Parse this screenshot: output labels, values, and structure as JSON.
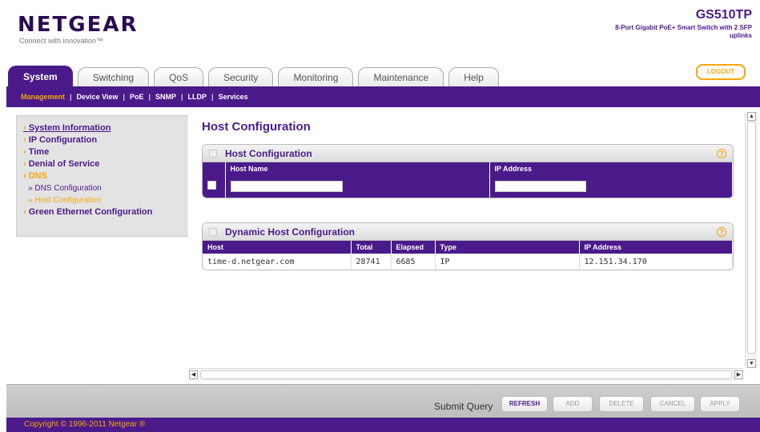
{
  "header": {
    "logo": "NETGEAR",
    "tagline": "Connect with Innovation™",
    "model": "GS510TP",
    "model_desc": "8-Port Gigabit PoE+ Smart Switch with 2 SFP uplinks",
    "logout_label": "LOGOUT"
  },
  "tabs": [
    {
      "label": "System"
    },
    {
      "label": "Switching"
    },
    {
      "label": "QoS"
    },
    {
      "label": "Security"
    },
    {
      "label": "Monitoring"
    },
    {
      "label": "Maintenance"
    },
    {
      "label": "Help"
    }
  ],
  "subnav": [
    {
      "label": "Management"
    },
    {
      "label": "Device View"
    },
    {
      "label": "PoE"
    },
    {
      "label": "SNMP"
    },
    {
      "label": "LLDP"
    },
    {
      "label": "Services"
    }
  ],
  "left_nav": {
    "items": [
      {
        "label": "System Information"
      },
      {
        "label": "IP Configuration"
      },
      {
        "label": "Time"
      },
      {
        "label": "Denial of Service"
      },
      {
        "label": "DNS"
      },
      {
        "label": "DNS Configuration"
      },
      {
        "label": "Host Configuration"
      },
      {
        "label": "Green Ethernet Configuration"
      }
    ]
  },
  "page_title": "Host Configuration",
  "host_config": {
    "title": "Host Configuration",
    "columns": [
      "Host Name",
      "IP Address"
    ]
  },
  "dynamic_host": {
    "title": "Dynamic Host Configuration",
    "columns": [
      "Host",
      "Total",
      "Elapsed",
      "Type",
      "IP Address"
    ],
    "rows": [
      {
        "host": "time-d.netgear.com",
        "total": "28741",
        "elapsed": "6685",
        "type": "IP",
        "ip": "12.151.34.170"
      }
    ]
  },
  "buttons": {
    "submit_label": "Submit Query",
    "refresh": "REFRESH",
    "add": "ADD",
    "delete": "DELETE",
    "cancel": "CANCEL",
    "apply": "APPLY"
  },
  "footer": "Copyright © 1996-2011 Netgear ®",
  "colors": {
    "brand_purple": "#4a1a8a",
    "accent_orange": "#f7a60c"
  }
}
